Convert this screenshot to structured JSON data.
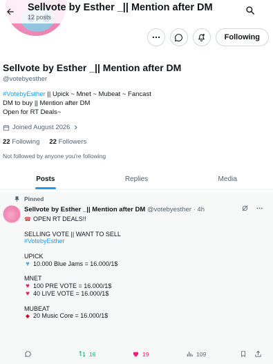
{
  "header": {
    "title": "Sellvote by Esther _|| Mention after DM",
    "posts_count": "12 posts"
  },
  "actions": {
    "follow_label": "Following"
  },
  "profile": {
    "display_name": "Sellvote by Esther _|| Mention after DM",
    "handle": "@votebyesther",
    "bio_tag": "#VotebyEsther",
    "bio_line1_rest": " || Upick ~ Mnet ~ Mubeat ~ Fancast",
    "bio_line2": "DM to buy || Mention after DM",
    "bio_line3": "Open for RT Deals~",
    "joined": "Joined August 2026",
    "following_count": "22",
    "following_label": "Following",
    "followers_count": "22",
    "followers_label": "Followers",
    "not_followed": "Not followed by anyone you're following"
  },
  "tabs": [
    {
      "label": "Posts",
      "active": true
    },
    {
      "label": "Replies",
      "active": false
    },
    {
      "label": "Media",
      "active": false
    }
  ],
  "post": {
    "pinned_label": "Pinned",
    "author": "Sellvote by Esther _|| Mention after DM",
    "meta": "@votebyesther · 4h",
    "lines": {
      "l1": "OPEN RT DEALS!!",
      "l2": "SELLING VOTE || WANT TO SELL",
      "l3": "#VotebyEsther",
      "l4": "UPICK",
      "l5": "10.000 Blue Jams = 16.000/1$",
      "l6": "MNET",
      "l7": "100 PRE VOTE = 16.000/1$",
      "l8": "40 LIVE VOTE = 16.000/1$",
      "l9": "MUBEAT",
      "l10": "20 Music Core = 16.000/1$"
    },
    "emoji": {
      "phone": "☎",
      "blue_heart": "♥",
      "heart": "♥",
      "ticket": "◆"
    },
    "stats": {
      "reposts": "16",
      "likes": "19",
      "views": "109"
    }
  },
  "colors": {
    "accent": "#1d9bf0",
    "repost": "#00ba7c",
    "like": "#f91880",
    "muted": "#536471"
  }
}
